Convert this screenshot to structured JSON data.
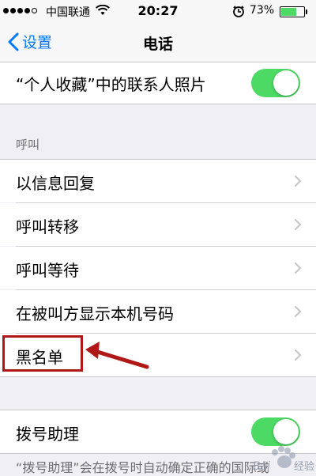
{
  "status_bar": {
    "carrier": "中国联通",
    "time": "20:27",
    "battery_percent": "73%",
    "battery_level": 0.73,
    "signal_bars_filled": 4,
    "icons": [
      "signal-icon",
      "wifi-icon",
      "alarm-icon",
      "battery-icon"
    ]
  },
  "nav": {
    "back_label": "设置",
    "title": "电话"
  },
  "rows": {
    "favorites_photos": {
      "label": "“个人收藏”中的联系人照片",
      "toggle_on": true
    },
    "section_calls": "呼叫",
    "reply_with_message": "以信息回复",
    "call_forwarding": "呼叫转移",
    "call_waiting": "呼叫等待",
    "show_caller_id": "在被叫方显示本机号码",
    "blocked": "黑名单",
    "dial_assist": {
      "label": "拨号助理",
      "toggle_on": true
    },
    "dial_assist_footer": "“拨号助理”会在拨号时自动确定正确的国际或"
  },
  "colors": {
    "accent": "#007aff",
    "toggle_on": "#4cd964",
    "highlight": "#b01818",
    "background": "#efeff4"
  },
  "watermark": {
    "text": "Bai 经验"
  }
}
